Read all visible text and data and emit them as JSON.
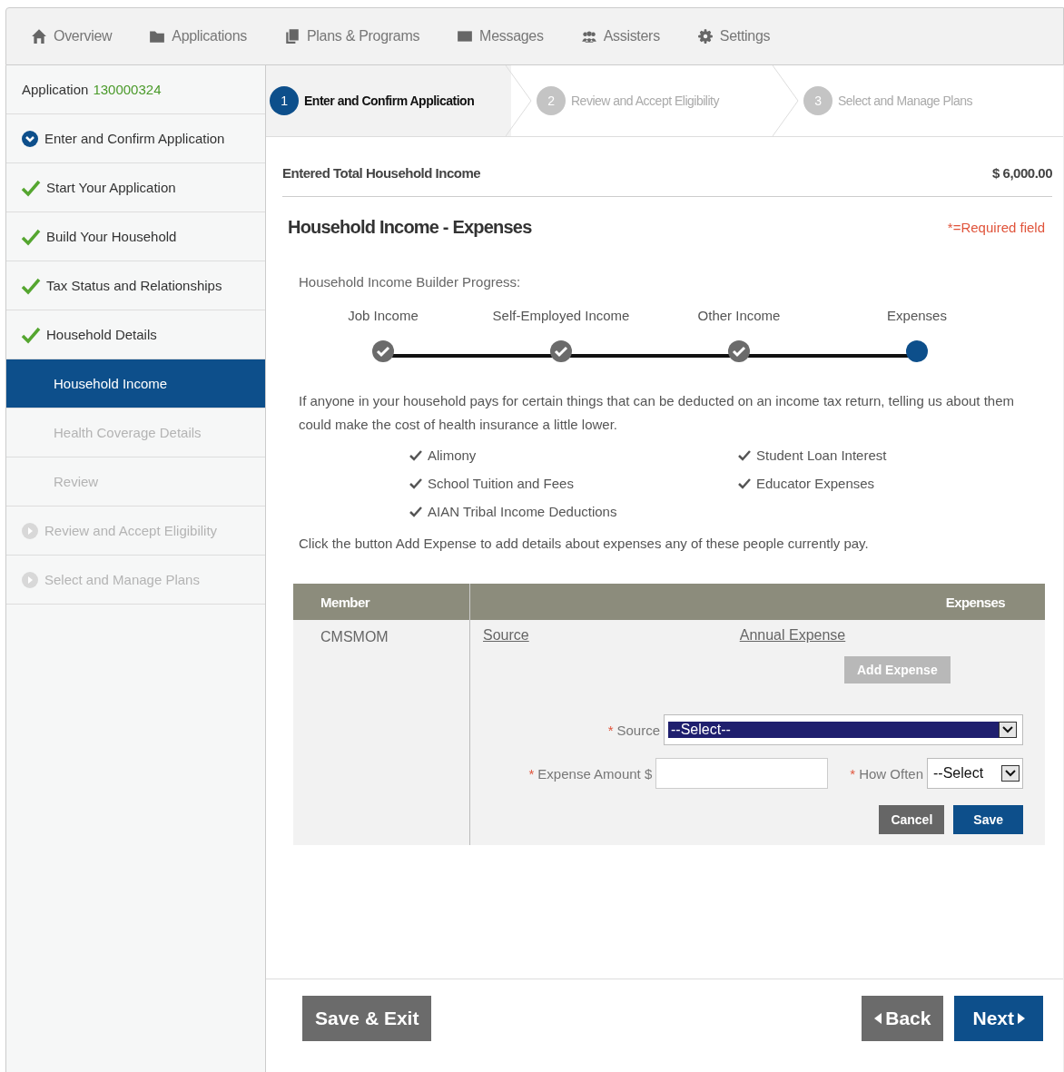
{
  "nav": [
    "Overview",
    "Applications",
    "Plans & Programs",
    "Messages",
    "Assisters",
    "Settings"
  ],
  "sidebar": {
    "application_label": "Application",
    "application_number": "130000324",
    "items": [
      {
        "label": "Enter and Confirm Application",
        "kind": "section",
        "completed": false,
        "disabled": false,
        "selected": false
      },
      {
        "label": "Start Your Application",
        "kind": "step",
        "completed": true,
        "disabled": false,
        "selected": false
      },
      {
        "label": "Build Your Household",
        "kind": "step",
        "completed": true,
        "disabled": false,
        "selected": false
      },
      {
        "label": "Tax Status and Relationships",
        "kind": "step",
        "completed": true,
        "disabled": false,
        "selected": false
      },
      {
        "label": "Household Details",
        "kind": "step",
        "completed": true,
        "disabled": false,
        "selected": false
      },
      {
        "label": "Household Income",
        "kind": "step",
        "completed": false,
        "disabled": false,
        "selected": true
      },
      {
        "label": "Health Coverage Details",
        "kind": "step",
        "completed": false,
        "disabled": true,
        "selected": false
      },
      {
        "label": "Review",
        "kind": "step",
        "completed": false,
        "disabled": true,
        "selected": false
      },
      {
        "label": "Review and Accept Eligibility",
        "kind": "section",
        "completed": false,
        "disabled": true,
        "selected": false
      },
      {
        "label": "Select and Manage Plans",
        "kind": "section",
        "completed": false,
        "disabled": true,
        "selected": false
      }
    ]
  },
  "stepper": [
    {
      "number": "1",
      "label": "Enter and Confirm Application",
      "selected": true
    },
    {
      "number": "2",
      "label": "Review and Accept Eligibility",
      "selected": false
    },
    {
      "number": "3",
      "label": "Select and Manage Plans",
      "selected": false
    }
  ],
  "income_total": {
    "label": "Entered Total Household Income",
    "value": "$ 6,000.00"
  },
  "title": "Household Income - Expenses",
  "required_note": "*=Required field",
  "progress_label": "Household Income Builder Progress:",
  "progress": [
    {
      "label": "Job Income",
      "completed": true
    },
    {
      "label": "Self-Employed Income",
      "completed": true
    },
    {
      "label": "Other Income",
      "completed": true
    },
    {
      "label": "Expenses",
      "completed": false
    }
  ],
  "intro": "If anyone in your household pays for certain things that can be deducted on an income tax return, telling us about them could make the cost of health insurance a little lower.",
  "deductions": [
    "Alimony",
    "Student Loan Interest",
    "School Tuition and Fees",
    "Educator Expenses",
    "AIAN Tribal Income Deductions"
  ],
  "instruction": "Click the button Add Expense to add details about expenses any of these people currently pay.",
  "table": {
    "columns": [
      "Member",
      "Expenses"
    ],
    "member": "CMSMOM",
    "links": [
      "Source",
      "Annual Expense"
    ],
    "add_button": {
      "label": "Add Expense",
      "disabled": true
    },
    "source": {
      "mark": "*",
      "label": "Source",
      "value": "--Select--"
    },
    "amount": {
      "mark": "*",
      "label": "Expense Amount",
      "prefix": "$"
    },
    "how_often": {
      "mark": "*",
      "label": "How Often",
      "value": "--Select"
    },
    "buttons": [
      "Cancel",
      "Save"
    ]
  },
  "footer": {
    "save_exit": "Save & Exit",
    "back": "Back",
    "next": "Next"
  }
}
